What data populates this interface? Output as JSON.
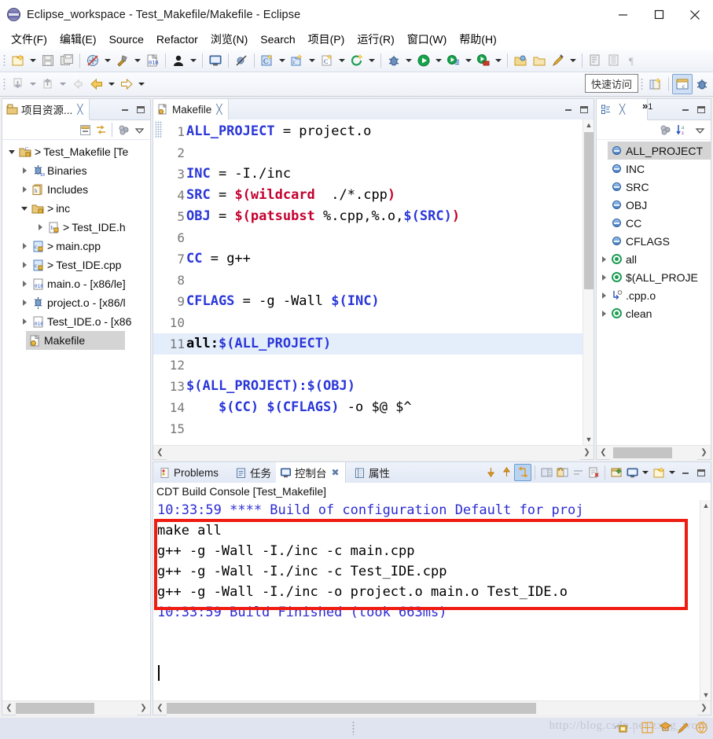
{
  "window": {
    "title": "Eclipse_workspace - Test_Makefile/Makefile - Eclipse",
    "app_icon": "eclipse-icon",
    "minimize_label": "Minimize",
    "maximize_label": "Maximize",
    "close_label": "Close"
  },
  "menubar": {
    "items": [
      {
        "label": "文件(F)",
        "name": "menu-file"
      },
      {
        "label": "编辑(E)",
        "name": "menu-edit"
      },
      {
        "label": "Source",
        "name": "menu-source"
      },
      {
        "label": "Refactor",
        "name": "menu-refactor"
      },
      {
        "label": "浏览(N)",
        "name": "menu-navigate"
      },
      {
        "label": "Search",
        "name": "menu-search"
      },
      {
        "label": "项目(P)",
        "name": "menu-project"
      },
      {
        "label": "运行(R)",
        "name": "menu-run"
      },
      {
        "label": "窗口(W)",
        "name": "menu-window"
      },
      {
        "label": "帮助(H)",
        "name": "menu-help"
      }
    ]
  },
  "toolbar": {
    "quick_access_placeholder": "快速访问",
    "row1_icons": [
      "new-wizard-icon",
      "save-icon",
      "save-all-icon",
      "build-all-icon",
      "build-hammer-icon",
      "binary-010-icon",
      "user-icon",
      "console-icon",
      "skip-breakpoints-icon",
      "new-c-project-icon",
      "new-cpp-class-icon",
      "new-c-file-icon",
      "refresh-icon",
      "debug-icon",
      "run-icon",
      "run-config-icon",
      "run-external-icon",
      "open-folder-icon",
      "open-type-icon",
      "marker-icon",
      "new-task-icon",
      "show-list-icon",
      "paragraph-icon"
    ],
    "row2_icons": [
      "annotation-down-icon",
      "annotation-up-icon",
      "back-dim-icon",
      "back-icon",
      "forward-icon"
    ],
    "perspective_icons": [
      "open-perspective-icon",
      "cpp-perspective-icon",
      "debug-perspective-icon"
    ]
  },
  "explorer": {
    "tab_label": "项目资源...",
    "tab_icon": "project-explorer-icon",
    "tab_close": "╳",
    "toolbar_icons": [
      "collapse-all-icon",
      "link-with-editor-icon",
      "focus-icon",
      "view-menu-icon"
    ],
    "tree": [
      {
        "indent": 0,
        "twisty": "down",
        "icon": "c-project-icon",
        "carat": ">",
        "label": "Test_Makefile [Te",
        "name": "tree-item-test-makefile"
      },
      {
        "indent": 1,
        "twisty": "right",
        "icon": "binaries-icon",
        "carat": "",
        "label": "Binaries",
        "name": "tree-item-binaries"
      },
      {
        "indent": 1,
        "twisty": "right",
        "icon": "includes-icon",
        "carat": "",
        "label": "Includes",
        "name": "tree-item-includes"
      },
      {
        "indent": 1,
        "twisty": "down",
        "icon": "folder-src-icon",
        "carat": ">",
        "label": "inc",
        "name": "tree-item-inc"
      },
      {
        "indent": 2,
        "twisty": "right",
        "icon": "header-file-icon",
        "carat": ">",
        "label": "Test_IDE.h",
        "name": "tree-item-test-ide-h"
      },
      {
        "indent": 1,
        "twisty": "right",
        "icon": "cpp-file-icon",
        "carat": ">",
        "label": "main.cpp",
        "name": "tree-item-main-cpp"
      },
      {
        "indent": 1,
        "twisty": "right",
        "icon": "cpp-file-icon",
        "carat": ">",
        "label": "Test_IDE.cpp",
        "name": "tree-item-test-ide-cpp"
      },
      {
        "indent": 1,
        "twisty": "right",
        "icon": "object-file-icon",
        "carat": "",
        "label": "main.o - [x86/le]",
        "name": "tree-item-main-o"
      },
      {
        "indent": 1,
        "twisty": "right",
        "icon": "binary-exe-icon",
        "carat": "",
        "label": "project.o - [x86/l",
        "name": "tree-item-project-o"
      },
      {
        "indent": 1,
        "twisty": "right",
        "icon": "object-file-icon",
        "carat": "",
        "label": "Test_IDE.o - [x86",
        "name": "tree-item-test-ide-o"
      },
      {
        "indent": 1,
        "twisty": "none",
        "icon": "makefile-icon",
        "carat": "",
        "label": "Makefile",
        "name": "tree-item-makefile",
        "selected": true
      }
    ]
  },
  "editor": {
    "tab_label": "Makefile",
    "tab_icon": "makefile-icon",
    "tab_close": "╳",
    "highlight_line": 11,
    "lines": [
      {
        "n": 1,
        "tokens": [
          {
            "t": "ALL_PROJECT",
            "c": "var"
          },
          {
            "t": " = project.o",
            "c": "plain"
          }
        ]
      },
      {
        "n": 2,
        "tokens": []
      },
      {
        "n": 3,
        "tokens": [
          {
            "t": "INC",
            "c": "var"
          },
          {
            "t": " = -I./inc",
            "c": "plain"
          }
        ]
      },
      {
        "n": 4,
        "tokens": [
          {
            "t": "SRC",
            "c": "var"
          },
          {
            "t": " = ",
            "c": "plain"
          },
          {
            "t": "$(wildcard",
            "c": "fn"
          },
          {
            "t": "  ./*.cpp",
            "c": "plain"
          },
          {
            "t": ")",
            "c": "fn"
          }
        ]
      },
      {
        "n": 5,
        "tokens": [
          {
            "t": "OBJ",
            "c": "var"
          },
          {
            "t": " = ",
            "c": "plain"
          },
          {
            "t": "$(patsubst",
            "c": "fn"
          },
          {
            "t": " %.cpp,%.o,",
            "c": "plain"
          },
          {
            "t": "$(SRC)",
            "c": "ref"
          },
          {
            "t": ")",
            "c": "fn"
          }
        ]
      },
      {
        "n": 6,
        "tokens": []
      },
      {
        "n": 7,
        "tokens": [
          {
            "t": "CC",
            "c": "var"
          },
          {
            "t": " = g++",
            "c": "plain"
          }
        ]
      },
      {
        "n": 8,
        "tokens": []
      },
      {
        "n": 9,
        "tokens": [
          {
            "t": "CFLAGS",
            "c": "var"
          },
          {
            "t": " = -g -Wall ",
            "c": "plain"
          },
          {
            "t": "$(INC)",
            "c": "ref"
          }
        ]
      },
      {
        "n": 10,
        "tokens": []
      },
      {
        "n": 11,
        "tokens": [
          {
            "t": "all:",
            "c": "tgt"
          },
          {
            "t": "$(ALL_PROJECT)",
            "c": "ref"
          }
        ]
      },
      {
        "n": 12,
        "tokens": []
      },
      {
        "n": 13,
        "tokens": [
          {
            "t": "$(ALL_PROJECT):$(OBJ)",
            "c": "ref"
          }
        ]
      },
      {
        "n": 14,
        "tokens": [
          {
            "t": "    ",
            "c": "plain"
          },
          {
            "t": "$(CC)",
            "c": "ref"
          },
          {
            "t": " ",
            "c": "plain"
          },
          {
            "t": "$(CFLAGS)",
            "c": "ref"
          },
          {
            "t": " -o $@ $^",
            "c": "plain"
          }
        ]
      },
      {
        "n": 15,
        "tokens": []
      }
    ]
  },
  "outline": {
    "tab_icon": "outline-icon",
    "tab_close": "╳",
    "overflow_label": "»",
    "overflow_count": "1",
    "toolbar_icons": [
      "hide-fields-icon",
      "sort-az-icon",
      "view-menu-icon"
    ],
    "items": [
      {
        "twisty": "none",
        "icon": "macro-icon",
        "label": "ALL_PROJECT",
        "name": "outline-item-all-project",
        "selected": true
      },
      {
        "twisty": "none",
        "icon": "macro-icon",
        "label": "INC",
        "name": "outline-item-inc"
      },
      {
        "twisty": "none",
        "icon": "macro-icon",
        "label": "SRC",
        "name": "outline-item-src"
      },
      {
        "twisty": "none",
        "icon": "macro-icon",
        "label": "OBJ",
        "name": "outline-item-obj"
      },
      {
        "twisty": "none",
        "icon": "macro-icon",
        "label": "CC",
        "name": "outline-item-cc"
      },
      {
        "twisty": "none",
        "icon": "macro-icon",
        "label": "CFLAGS",
        "name": "outline-item-cflags"
      },
      {
        "twisty": "right",
        "icon": "target-icon",
        "label": "all",
        "name": "outline-item-all"
      },
      {
        "twisty": "right",
        "icon": "target-icon",
        "label": "$(ALL_PROJE",
        "name": "outline-item-all-project-target"
      },
      {
        "twisty": "right",
        "icon": "rule-icon",
        "label": ".cpp.o",
        "name": "outline-item-cpp-o"
      },
      {
        "twisty": "right",
        "icon": "target-icon",
        "label": "clean",
        "name": "outline-item-clean"
      }
    ]
  },
  "console": {
    "tabs": [
      {
        "label": "Problems",
        "icon": "problems-icon",
        "active": false,
        "name": "tab-problems"
      },
      {
        "label": "任务",
        "icon": "tasks-icon",
        "active": false,
        "name": "tab-tasks"
      },
      {
        "label": "控制台",
        "icon": "console-icon",
        "active": true,
        "name": "tab-console"
      },
      {
        "label": "属性",
        "icon": "properties-icon",
        "active": false,
        "name": "tab-properties"
      }
    ],
    "toolbar_icons": [
      "scroll-down-icon",
      "scroll-up-icon",
      "scroll-lock-icon",
      "clear-console-icon",
      "pin-console-icon",
      "word-wrap-icon",
      "remove-launch-icon",
      "open-console-icon",
      "display-console-icon",
      "display-dropdown-icon",
      "new-console-icon",
      "new-console-dropdown-icon",
      "minimize-icon",
      "maximize-icon"
    ],
    "header": "CDT Build Console [Test_Makefile]",
    "lines": [
      {
        "text": "10:33:59 **** Build of configuration Default for proj",
        "color": "blue"
      },
      {
        "text": "make all",
        "color": "black"
      },
      {
        "text": "g++ -g -Wall -I./inc -c main.cpp",
        "color": "black"
      },
      {
        "text": "g++ -g -Wall -I./inc -c Test_IDE.cpp",
        "color": "black"
      },
      {
        "text": "g++ -g -Wall -I./inc -o project.o main.o Test_IDE.o",
        "color": "black"
      },
      {
        "text": "",
        "color": "black"
      },
      {
        "text": "10:33:59 Build Finished (took 663ms)",
        "color": "blue"
      }
    ],
    "highlight_box_color": "#ee1c11"
  },
  "statusbar": {
    "watermark": "http://blog.csdn.net/zxng_work",
    "icons": [
      "writable-icon",
      "smart-insert-icon",
      "editor-mode-icon",
      "pen-icon",
      "help-icon"
    ]
  }
}
